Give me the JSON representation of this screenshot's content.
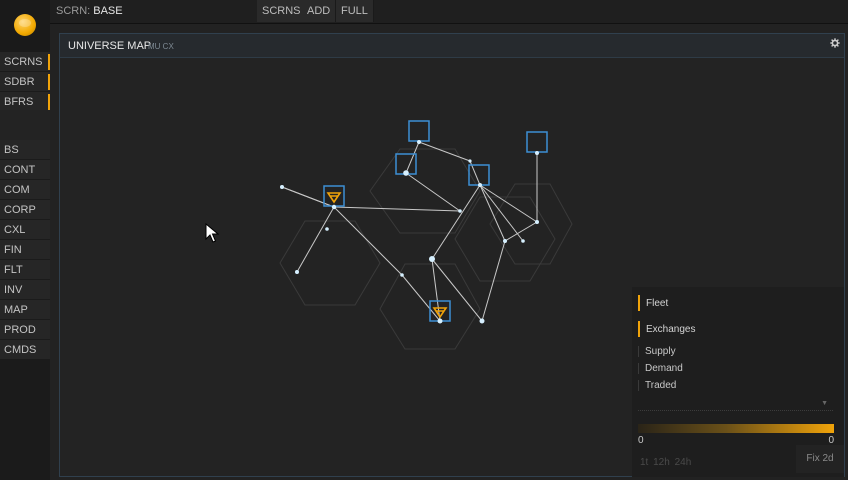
{
  "topbar": {
    "scrn_label": "SCRN:",
    "scrn_value": "BASE",
    "buttons": [
      "SCRNS",
      "ADD",
      "FULL"
    ]
  },
  "logo": {
    "icon": "orange-planet-logo-icon",
    "color": "#f2a900"
  },
  "sidebar": {
    "group1": [
      "SCRNS",
      "SDBR",
      "BFRS"
    ],
    "group2": [
      "BS",
      "CONT",
      "COM",
      "CORP",
      "CXL",
      "FIN",
      "FLT",
      "INV",
      "MAP",
      "PROD",
      "CMDS"
    ]
  },
  "panel": {
    "title": "UNIVERSE MAP",
    "subtitle": "MU CX",
    "settings_icon": "gear-icon"
  },
  "legend": {
    "toggles": [
      "Fleet",
      "Exchanges"
    ],
    "modes": [
      "Supply",
      "Demand",
      "Traded"
    ],
    "scale_min": "0",
    "scale_max": "0",
    "time_options": "1t  12h  24h",
    "fix_button": "Fix 2d"
  },
  "colors": {
    "accent": "#f0a30a",
    "node": "#d6f0ff",
    "station_box": "#3c8fd4",
    "route": "#c9c9c9",
    "hex_grid": "#3a3a3a"
  }
}
